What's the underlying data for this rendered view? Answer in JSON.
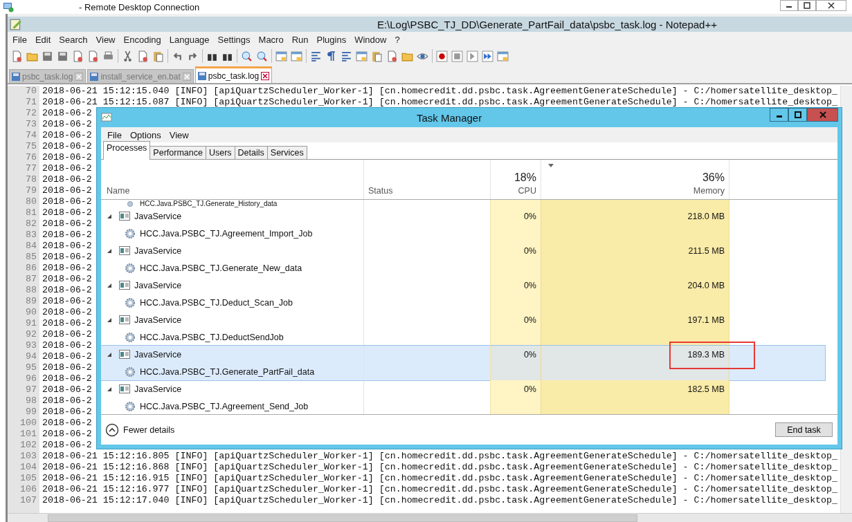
{
  "remote_desktop": {
    "title": "- Remote Desktop Connection"
  },
  "notepad": {
    "title": "E:\\Log\\PSBC_TJ_DD\\Generate_PartFail_data\\psbc_task.log - Notepad++",
    "menu": [
      "File",
      "Edit",
      "Search",
      "View",
      "Encoding",
      "Language",
      "Settings",
      "Macro",
      "Run",
      "Plugins",
      "Window",
      "?"
    ],
    "tabs": [
      {
        "label": "psbc_task.log",
        "selected": false
      },
      {
        "label": "install_service_en.bat",
        "selected": false
      },
      {
        "label": "psbc_task.log",
        "selected": true
      }
    ],
    "lines": [
      {
        "number": "70",
        "text": "2018-06-21 15:12:15.040 [INFO] [apiQuartzScheduler_Worker-1] [cn.homecredit.dd.psbc.task.AgreementGenerateSchedule] - C:/homersatellite_desktop_"
      },
      {
        "number": "71",
        "text": "2018-06-21 15:12:15.087 [INFO] [apiQuartzScheduler_Worker-1] [cn.homecredit.dd.psbc.task.AgreementGenerateSchedule] - C:/homersatellite_desktop_"
      },
      {
        "number": "72",
        "text": "2018-06-2"
      },
      {
        "number": "73",
        "text": "2018-06-2"
      },
      {
        "number": "74",
        "text": "2018-06-2"
      },
      {
        "number": "75",
        "text": "2018-06-2"
      },
      {
        "number": "76",
        "text": "2018-06-2"
      },
      {
        "number": "77",
        "text": "2018-06-2"
      },
      {
        "number": "78",
        "text": "2018-06-2"
      },
      {
        "number": "79",
        "text": "2018-06-2"
      },
      {
        "number": "80",
        "text": "2018-06-2"
      },
      {
        "number": "81",
        "text": "2018-06-2"
      },
      {
        "number": "82",
        "text": "2018-06-2"
      },
      {
        "number": "83",
        "text": "2018-06-2"
      },
      {
        "number": "84",
        "text": "2018-06-2"
      },
      {
        "number": "85",
        "text": "2018-06-2"
      },
      {
        "number": "86",
        "text": "2018-06-2"
      },
      {
        "number": "87",
        "text": "2018-06-2"
      },
      {
        "number": "88",
        "text": "2018-06-2"
      },
      {
        "number": "89",
        "text": "2018-06-2"
      },
      {
        "number": "90",
        "text": "2018-06-2"
      },
      {
        "number": "91",
        "text": "2018-06-2"
      },
      {
        "number": "92",
        "text": "2018-06-2"
      },
      {
        "number": "93",
        "text": "2018-06-2"
      },
      {
        "number": "94",
        "text": "2018-06-2"
      },
      {
        "number": "95",
        "text": "2018-06-2"
      },
      {
        "number": "96",
        "text": "2018-06-2"
      },
      {
        "number": "97",
        "text": "2018-06-2"
      },
      {
        "number": "98",
        "text": "2018-06-2"
      },
      {
        "number": "99",
        "text": "2018-06-2"
      },
      {
        "number": "100",
        "text": "2018-06-2"
      },
      {
        "number": "101",
        "text": "2018-06-2"
      },
      {
        "number": "102",
        "text": "2018-06-2"
      },
      {
        "number": "103",
        "text": "2018-06-21 15:12:16.805 [INFO] [apiQuartzScheduler_Worker-1] [cn.homecredit.dd.psbc.task.AgreementGenerateSchedule] - C:/homersatellite_desktop_"
      },
      {
        "number": "104",
        "text": "2018-06-21 15:12:16.868 [INFO] [apiQuartzScheduler_Worker-1] [cn.homecredit.dd.psbc.task.AgreementGenerateSchedule] - C:/homersatellite_desktop_"
      },
      {
        "number": "105",
        "text": "2018-06-21 15:12:16.915 [INFO] [apiQuartzScheduler_Worker-1] [cn.homecredit.dd.psbc.task.AgreementGenerateSchedule] - C:/homersatellite_desktop_"
      },
      {
        "number": "106",
        "text": "2018-06-21 15:12:16.977 [INFO] [apiQuartzScheduler_Worker-1] [cn.homecredit.dd.psbc.task.AgreementGenerateSchedule] - C:/homersatellite_desktop_"
      },
      {
        "number": "107",
        "text": "2018-06-21 15:12:17.040 [INFO] [apiQuartzScheduler_Worker-1] [cn.homecredit.dd.psbc.task.AgreementGenerateSchedule] - C:/homersatellite_desktop_"
      }
    ]
  },
  "task_manager": {
    "title": "Task Manager",
    "menu": [
      "File",
      "Options",
      "View"
    ],
    "tabs": [
      {
        "label": "Processes",
        "selected": true
      },
      {
        "label": "Performance",
        "selected": false
      },
      {
        "label": "Users",
        "selected": false
      },
      {
        "label": "Details",
        "selected": false
      },
      {
        "label": "Services",
        "selected": false
      }
    ],
    "columns": {
      "name": "Name",
      "status": "Status",
      "cpu_total": "18%",
      "cpu": "CPU",
      "memory_total": "36%",
      "memory": "Memory"
    },
    "clipped_row": "HCC.Java.PSBC_TJ.Generate_History_data",
    "processes": [
      {
        "name": "JavaService",
        "expanded": true,
        "selected": false,
        "annotated": false,
        "cpu": "0%",
        "memory": "218.0 MB",
        "children": [
          {
            "name": "HCC.Java.PSBC_TJ.Agreement_Import_Job"
          }
        ]
      },
      {
        "name": "JavaService",
        "expanded": true,
        "selected": false,
        "annotated": false,
        "cpu": "0%",
        "memory": "211.5 MB",
        "children": [
          {
            "name": "HCC.Java.PSBC_TJ.Generate_New_data"
          }
        ]
      },
      {
        "name": "JavaService",
        "expanded": true,
        "selected": false,
        "annotated": false,
        "cpu": "0%",
        "memory": "204.0 MB",
        "children": [
          {
            "name": "HCC.Java.PSBC_TJ.Deduct_Scan_Job"
          }
        ]
      },
      {
        "name": "JavaService",
        "expanded": true,
        "selected": false,
        "annotated": false,
        "cpu": "0%",
        "memory": "197.1 MB",
        "children": [
          {
            "name": "HCC.Java.PSBC_TJ.DeductSendJob"
          }
        ]
      },
      {
        "name": "JavaService",
        "expanded": true,
        "selected": true,
        "annotated": true,
        "cpu": "0%",
        "memory": "189.3 MB",
        "children": [
          {
            "name": "HCC.Java.PSBC_TJ.Generate_PartFail_data"
          }
        ]
      },
      {
        "name": "JavaService",
        "expanded": true,
        "selected": false,
        "annotated": false,
        "cpu": "0%",
        "memory": "182.5 MB",
        "children": [
          {
            "name": "HCC.Java.PSBC_TJ.Agreement_Send_Job"
          }
        ]
      }
    ],
    "fewer_details": "Fewer details",
    "end_task": "End task"
  }
}
